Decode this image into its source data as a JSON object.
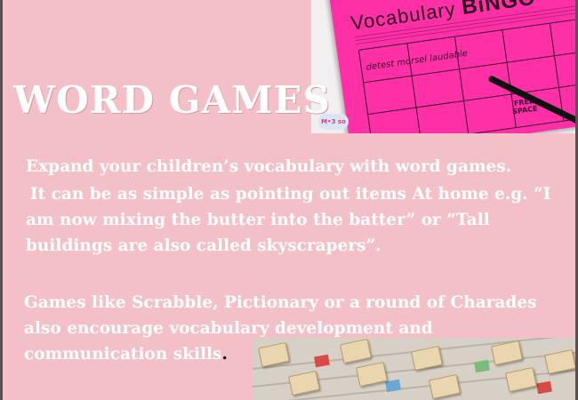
{
  "slide": {
    "title": "WORD GAMES",
    "paragraph_1": "Expand your children’s vocabulary with word games.",
    "paragraph_2": "It can be as simple as pointing out items At home  e.g. “I am now mixing the butter into the batter” or “Tall buildings are also called skyscrapers”.",
    "paragraph_3": "Games like Scrabble, Pictionary or a round of Charades also encourage vocabulary development and communication skills",
    "paragraph_3_end": "."
  },
  "bingo_image": {
    "heading_prefix": "Vocabulary ",
    "heading_bingo": "BiNGO",
    "sample_words": "detest   morsel   laudable",
    "free_space": "FREE\nSPACE",
    "logo_text": "M•3 so"
  },
  "colors": {
    "slide_background": "#f4c0c8",
    "text": "#ffffff",
    "bingo_sheet": "#ff2fa6"
  }
}
